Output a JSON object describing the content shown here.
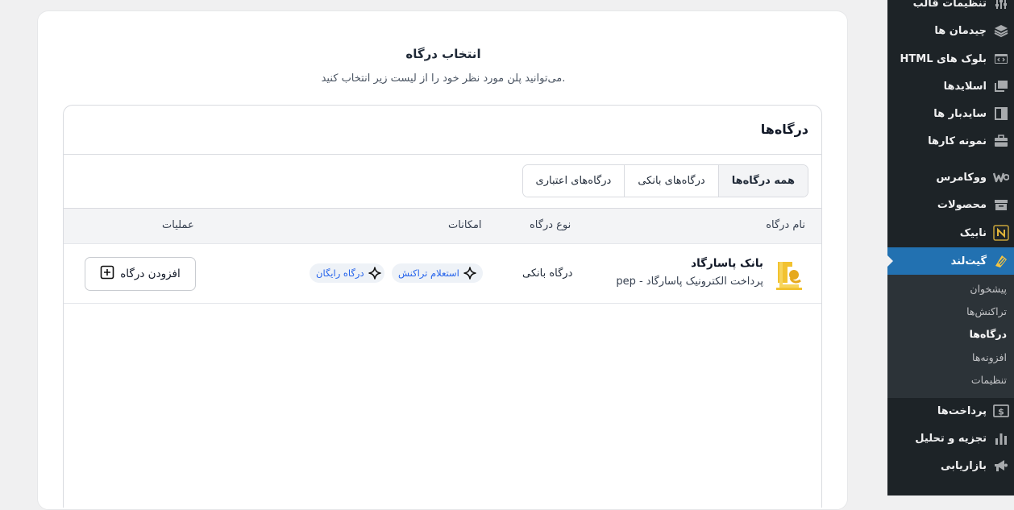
{
  "sidebar": {
    "items": [
      {
        "label": "تنظیمات قالب",
        "icon": "sliders-icon"
      },
      {
        "label": "چیدمان ها",
        "icon": "layers-icon"
      },
      {
        "label": "بلوک های HTML",
        "icon": "html-block-icon"
      },
      {
        "label": "اسلایدها",
        "icon": "slides-icon"
      },
      {
        "label": "سایدبار ها",
        "icon": "sidebar-icon"
      },
      {
        "label": "نمونه کارها",
        "icon": "briefcase-icon"
      },
      {
        "label": "ووکامرس",
        "icon": "woocommerce-icon"
      },
      {
        "label": "محصولات",
        "icon": "archive-box-icon"
      },
      {
        "label": "نابیک",
        "icon": "nabik-logo-icon"
      },
      {
        "label": "گیت‌لند",
        "icon": "gateland-logo-icon"
      },
      {
        "label": "پرداخت‌ها",
        "icon": "dollar-card-icon"
      },
      {
        "label": "تجزیه و تحلیل",
        "icon": "bar-chart-icon"
      },
      {
        "label": "بازاریابی",
        "icon": "megaphone-icon"
      }
    ],
    "submenu": [
      {
        "label": "پیشخوان"
      },
      {
        "label": "تراکنش‌ها"
      },
      {
        "label": "درگاه‌ها"
      },
      {
        "label": "افزونه‌ها"
      },
      {
        "label": "تنظیمات"
      }
    ],
    "colors": {
      "background": "#1d2327",
      "active": "#2271b1",
      "submenu_bg": "#2c3338"
    }
  },
  "header": {
    "title": "انتخاب درگاه",
    "subtitle": "می‌توانید پلن مورد نظر خود را از لیست زیر انتخاب کنید."
  },
  "panel": {
    "title": "درگاه‌ها",
    "tabs": [
      {
        "label": "همه درگاه‌ها",
        "active": true
      },
      {
        "label": "درگاه‌های بانکی",
        "active": false
      },
      {
        "label": "درگاه‌های اعتباری",
        "active": false
      }
    ],
    "columns": {
      "name": "نام درگاه",
      "type": "نوع درگاه",
      "features": "امکانات",
      "actions": "عملیات"
    },
    "rows": [
      {
        "name": "بانک پاسارگاد",
        "description": "پرداخت الکترونیک پاسارگاد - pep",
        "type": "درگاه بانکی",
        "features": [
          "استعلام تراکنش",
          "درگاه رایگان"
        ],
        "action_label": "افزودن درگاه",
        "logo_icon": "pasargad-bank-logo-icon"
      }
    ]
  },
  "accent_color": "#2563eb"
}
